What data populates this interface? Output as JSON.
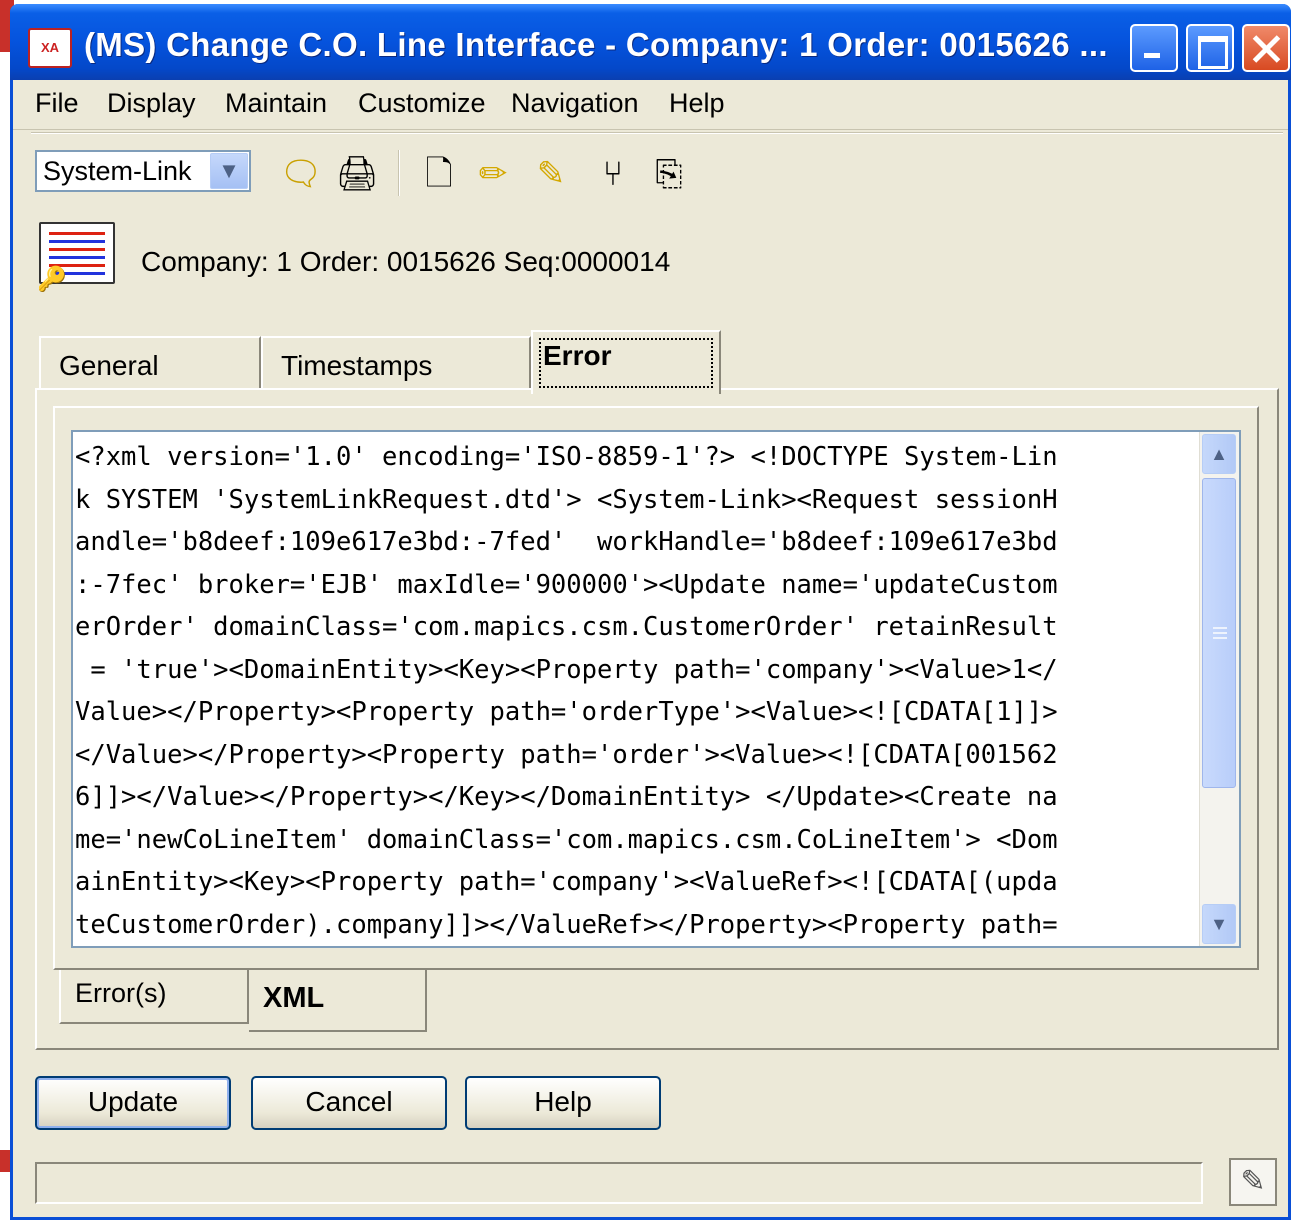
{
  "window": {
    "title": "(MS) Change C.O. Line Interface - Company: 1  Order: 0015626 ...",
    "app_icon_text": "XA"
  },
  "menu": [
    "File",
    "Display",
    "Maintain",
    "Customize",
    "Navigation",
    "Help"
  ],
  "toolbar": {
    "combo_value": "System-Link",
    "icons": [
      "notes-icon",
      "print-icon",
      "new-document-icon",
      "edit-pencil-icon",
      "edit-list-icon",
      "tree-icon",
      "copy-icon"
    ]
  },
  "header": {
    "order_info": "Company: 1  Order: 0015626 Seq:0000014"
  },
  "tabs": [
    {
      "label": "General",
      "active": false
    },
    {
      "label": "Timestamps",
      "active": false
    },
    {
      "label": "Error",
      "active": true
    }
  ],
  "xml_lines": [
    "<?xml version='1.0' encoding='ISO-8859-1'?> <!DOCTYPE System-Lin",
    "k SYSTEM 'SystemLinkRequest.dtd'> <System-Link><Request sessionH",
    "andle='b8deef:109e617e3bd:-7fed'  workHandle='b8deef:109e617e3bd",
    ":-7fec' broker='EJB' maxIdle='900000'><Update name='updateCustom",
    "erOrder' domainClass='com.mapics.csm.CustomerOrder' retainResult",
    " = 'true'><DomainEntity><Key><Property path='company'><Value>1</",
    "Value></Property><Property path='orderType'><Value><![CDATA[1]]>",
    "</Value></Property><Property path='order'><Value><![CDATA[001562",
    "6]]></Value></Property></Key></DomainEntity> </Update><Create na",
    "me='newCoLineItem' domainClass='com.mapics.csm.CoLineItem'> <Dom",
    "ainEntity><Key><Property path='company'><ValueRef><![CDATA[(upda",
    "teCustomerOrder).company]]></ValueRef></Property><Property path="
  ],
  "subtabs": [
    {
      "label": "Error(s)",
      "active": false
    },
    {
      "label": "XML",
      "active": true
    }
  ],
  "buttons": {
    "update": "Update",
    "cancel": "Cancel",
    "help": "Help"
  },
  "colors": {
    "titlebar": "#0553dd",
    "window_face": "#ece9d8",
    "close_button": "#d84a22"
  }
}
